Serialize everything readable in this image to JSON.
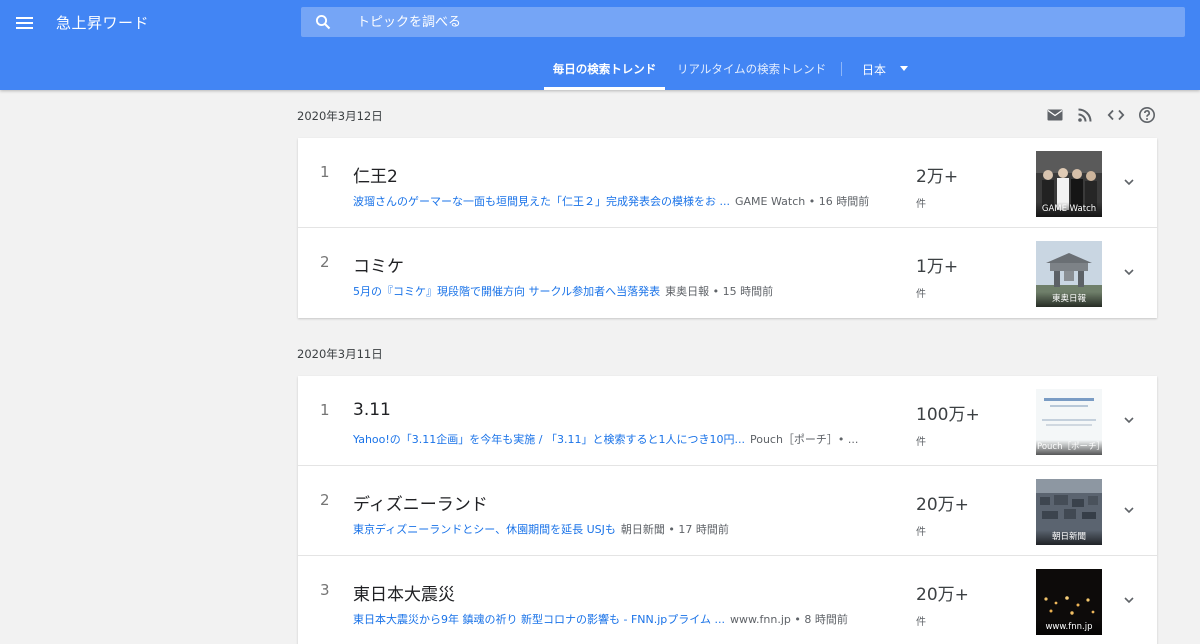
{
  "header": {
    "app_title": "急上昇ワード",
    "search_placeholder": "トピックを調べる",
    "tabs": [
      {
        "label": "毎日の検索トレンド",
        "active": true
      },
      {
        "label": "リアルタイムの検索トレンド",
        "active": false
      }
    ],
    "country": "日本"
  },
  "toolbar_icons": [
    "mail-icon",
    "rss-icon",
    "embed-code-icon",
    "help-icon"
  ],
  "days": [
    {
      "date": "2020年3月12日",
      "trends": [
        {
          "rank": "1",
          "title": "仁王2",
          "article": "波瑠さんのゲーマーな一面も垣間見えた「仁王２」完成発表会の模様をお ...",
          "source": "GAME Watch • 16 時間前",
          "count": "2万+",
          "unit": "件",
          "thumb_caption": "GAME Watch"
        },
        {
          "rank": "2",
          "title": "コミケ",
          "article": "5月の『コミケ』現段階で開催方向 サークル参加者へ当落発表",
          "source": "東奥日報 • 15 時間前",
          "count": "1万+",
          "unit": "件",
          "thumb_caption": "東奥日報"
        }
      ]
    },
    {
      "date": "2020年3月11日",
      "trends": [
        {
          "rank": "1",
          "title": "3.11",
          "article": "Yahoo!の「3.11企画」を今年も実施 / 「3.11」と検索すると1人につき10円...",
          "source": "Pouch［ポーチ］• ...",
          "count": "100万+",
          "unit": "件",
          "thumb_caption": "Pouch［ポーチ］"
        },
        {
          "rank": "2",
          "title": "ディズニーランド",
          "article": "東京ディズニーランドとシー、休園期間を延長 USJも",
          "source": "朝日新聞 • 17 時間前",
          "count": "20万+",
          "unit": "件",
          "thumb_caption": "朝日新聞"
        },
        {
          "rank": "3",
          "title": "東日本大震災",
          "article": "東日本大震災から9年 鎮魂の祈り 新型コロナの影響も - FNN.jpプライム ...",
          "source": "www.fnn.jp • 8 時間前",
          "count": "20万+",
          "unit": "件",
          "thumb_caption": "www.fnn.jp"
        }
      ]
    }
  ],
  "colors": {
    "header": "#4285f4",
    "search_box": "#75a5f6",
    "link": "#1a73e8",
    "page_bg": "#f2f2f2"
  }
}
